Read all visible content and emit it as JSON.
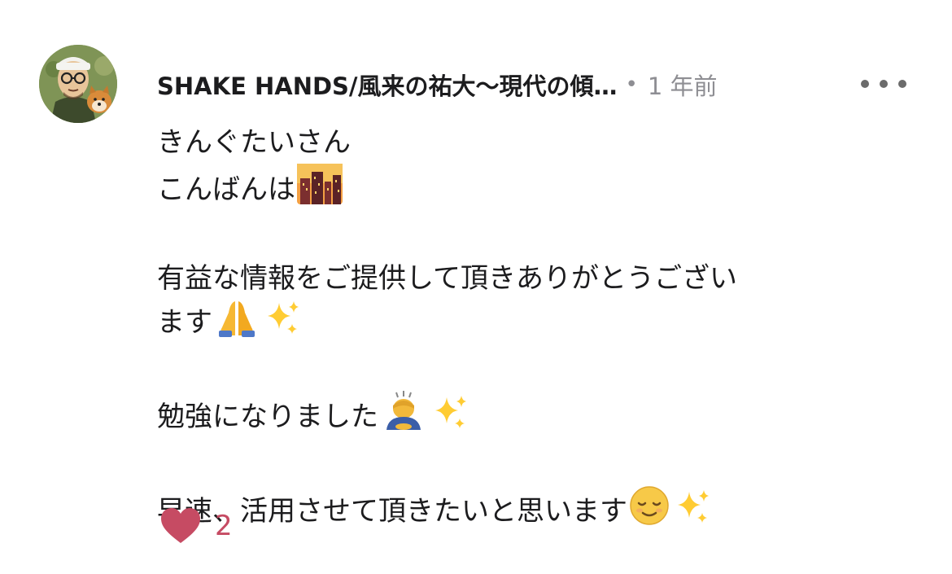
{
  "comment": {
    "author": "SHAKE HANDS/風来の祐大〜現代の傾…",
    "separator": "•",
    "time": "1 年前",
    "lines": [
      "きんぐたいさん",
      "こんばんは",
      "",
      "有益な情報をご提供して頂きありがとうござい",
      "ます",
      "",
      "勉強になりました",
      "",
      "早速、活用させて頂きたいと思います"
    ],
    "emojis": {
      "line_2": [
        "city-dusk-icon"
      ],
      "line_5": [
        "folded-hands-icon",
        "sparkles-icon"
      ],
      "line_7": [
        "person-bowing-icon",
        "sparkles-icon"
      ],
      "line_9": [
        "relieved-face-icon",
        "sparkles-icon"
      ]
    },
    "like_count": "2",
    "icons": {
      "like": "heart-icon",
      "more": "more-horizontal-icon"
    },
    "colors": {
      "heart": "#c64b63",
      "meta": "#8e8e93",
      "text": "#1c1c1e"
    }
  }
}
